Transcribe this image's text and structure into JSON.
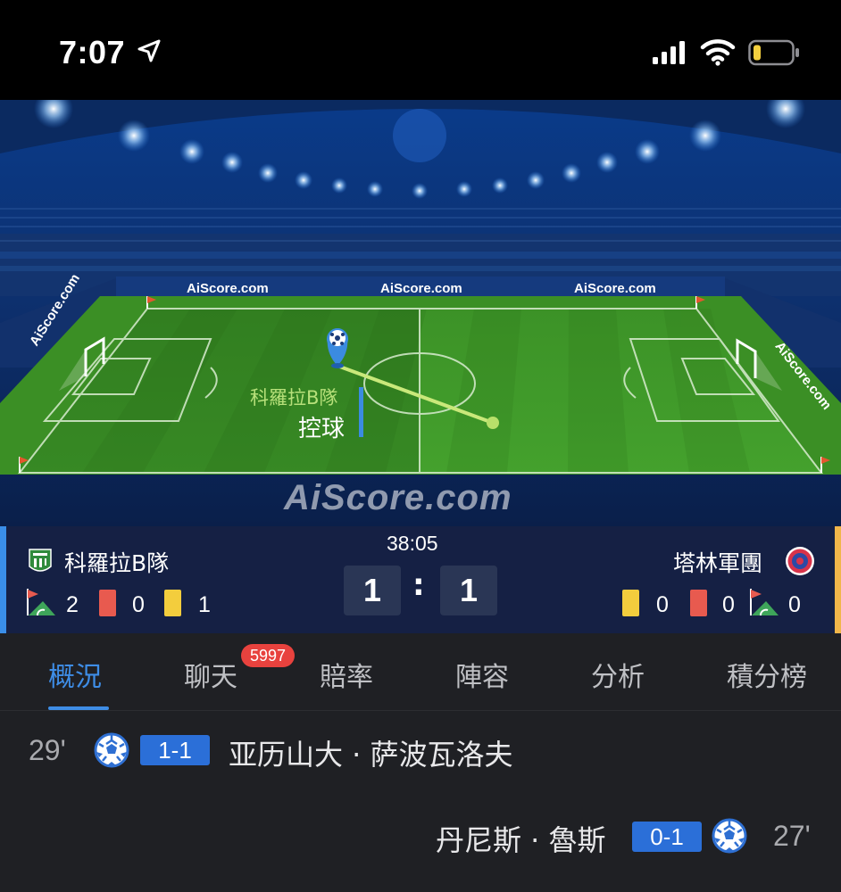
{
  "status_bar": {
    "time": "7:07",
    "icons": [
      "location-arrow-icon",
      "cellular-signal-icon",
      "wifi-icon",
      "battery-low-icon"
    ]
  },
  "pitch": {
    "brand_labels": [
      "AiScore.com",
      "AiScore.com",
      "AiScore.com"
    ],
    "side_brand_left": "AiScore.com",
    "side_brand_right": "AiScore.com",
    "big_brand": "AiScore.com",
    "possession_team": "科羅拉B隊",
    "possession_label": "控球",
    "colors": {
      "grass": "#3e8f24",
      "possession_line": "#c9e87a",
      "marker": "#3b8be0"
    }
  },
  "match": {
    "clock": "38:05",
    "home": {
      "name": "科羅拉B隊",
      "score": "1",
      "corners": "2",
      "red_cards": "0",
      "yellow_cards": "1",
      "edge_color": "#3a8ee8"
    },
    "away": {
      "name": "塔林軍團",
      "score": "1",
      "yellow_cards": "0",
      "red_cards": "0",
      "corners": "0",
      "edge_color": "#f1b64a"
    },
    "separator": ":"
  },
  "tabs": {
    "items": [
      {
        "label": "概況",
        "active": true
      },
      {
        "label": "聊天",
        "badge": "5997"
      },
      {
        "label": "賠率"
      },
      {
        "label": "陣容"
      },
      {
        "label": "分析"
      },
      {
        "label": "積分榜"
      }
    ],
    "accent": "#3e8de6"
  },
  "events": [
    {
      "minute": "29'",
      "score": "1-1",
      "player": "亚历山大 · 萨波瓦洛夫",
      "side": "home"
    },
    {
      "minute": "27'",
      "score": "0-1",
      "player": "丹尼斯 · 魯斯",
      "side": "away"
    }
  ]
}
